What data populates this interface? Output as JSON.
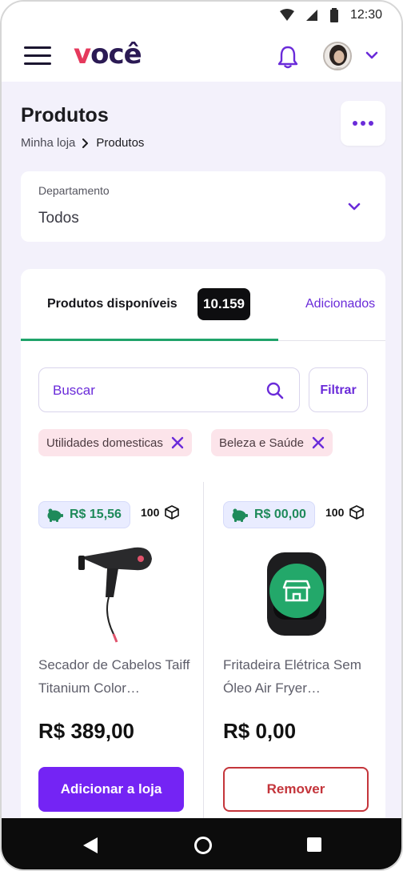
{
  "status_bar": {
    "time": "12:30"
  },
  "header": {
    "logo_text": "você",
    "menu_icon": "hamburger-icon",
    "notification_icon": "bell-icon",
    "avatar": "avatar",
    "account_chevron": "chevron-down-icon"
  },
  "page": {
    "title": "Produtos",
    "breadcrumb": {
      "parent": "Minha loja",
      "current": "Produtos"
    },
    "more_icon": "more-dots-icon"
  },
  "department": {
    "label": "Departamento",
    "value": "Todos"
  },
  "tabs": {
    "available": {
      "label": "Produtos disponíveis",
      "count": "10.159"
    },
    "added": {
      "label": "Adicionados"
    }
  },
  "search": {
    "placeholder": "Buscar",
    "filter_label": "Filtrar"
  },
  "filter_chips": [
    {
      "label": "Utilidades domesticas"
    },
    {
      "label": "Beleza e Saúde"
    }
  ],
  "products": [
    {
      "cashback": "R$ 15,56",
      "stock": "100",
      "name": "Secador de Cabelos Taiff Titanium Color…",
      "price": "R$ 389,00",
      "action": "Adicionar a loja"
    },
    {
      "cashback": "R$ 00,00",
      "stock": "100",
      "name": "Fritadeira Elétrica Sem Óleo Air Fryer…",
      "price": "R$ 0,00",
      "action": "Remover"
    }
  ],
  "colors": {
    "accent": "#7424f4",
    "link": "#6a2bd9",
    "success": "#1e8a5a",
    "danger": "#c4353b",
    "background": "#f3f1fb"
  }
}
